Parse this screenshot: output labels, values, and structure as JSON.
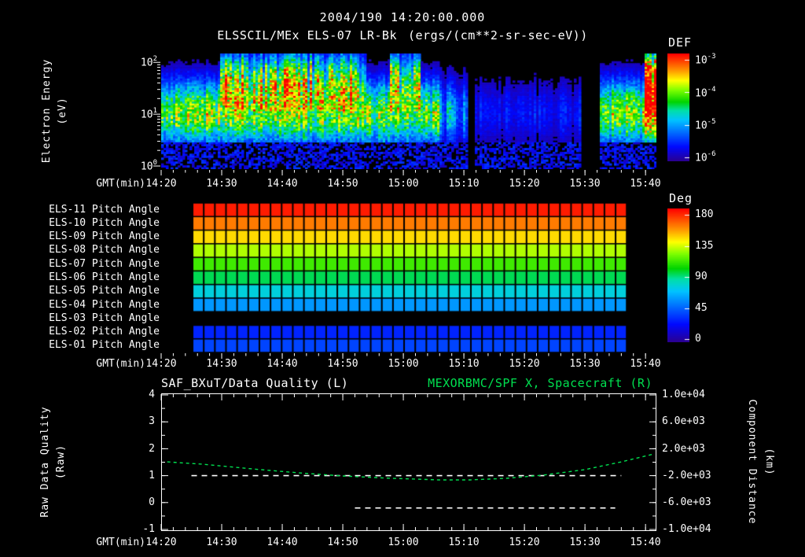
{
  "colors": {
    "background": "#000000",
    "text": "#ffffff",
    "accent_green": "#00e050",
    "axis": "#ffffff",
    "colormap": {
      "positions": [
        0,
        0.13,
        0.27,
        0.38,
        0.47,
        0.55,
        0.66,
        0.75,
        0.85,
        1.0
      ],
      "colors": [
        "#2a0092",
        "#0008ff",
        "#0070ff",
        "#00c3ff",
        "#00e0a8",
        "#00d400",
        "#7dff00",
        "#ffff00",
        "#ff9000",
        "#ff0000"
      ]
    }
  },
  "header": {
    "timestamp": "2004/190 14:20:00.000",
    "instrument": "ELSSCIL/MEx ELS-07 LR-Bk",
    "units": "(ergs/(cm**2-sr-sec-eV))"
  },
  "time_axis": {
    "label": "GMT(min)",
    "ticks": [
      "14:20",
      "14:30",
      "14:40",
      "14:50",
      "15:00",
      "15:10",
      "15:20",
      "15:30",
      "15:40"
    ],
    "minutes_total": 81.8,
    "minor_step_min": 2
  },
  "chart_data": [
    {
      "type": "heatmap",
      "name": "electron-energy-spectrogram",
      "title": "ELSSCIL/MEx ELS-07 LR-Bk",
      "units": "(ergs/(cm**2-sr-sec-eV))",
      "xlabel": "GMT(min)",
      "x_ticks": [
        "14:20",
        "14:30",
        "14:40",
        "14:50",
        "15:00",
        "15:10",
        "15:20",
        "15:30",
        "15:40"
      ],
      "ylabel": "Electron Energy",
      "ylabel_units": "(eV)",
      "y_scale": "log",
      "y_range_ev": [
        0.87,
        148
      ],
      "y_ticks": [
        {
          "base": "10",
          "exp": "2"
        },
        {
          "base": "10",
          "exp": "1"
        },
        {
          "base": "10",
          "exp": "0"
        }
      ],
      "colorbar_title": "DEF",
      "colorbar_ticks": [
        {
          "base": "10",
          "exp": "-3"
        },
        {
          "base": "10",
          "exp": "-4"
        },
        {
          "base": "10",
          "exp": "-5"
        },
        {
          "base": "10",
          "exp": "-6"
        }
      ],
      "colorbar_tick_fracs": [
        0.058,
        0.358,
        0.664,
        0.963
      ],
      "features": {
        "main_band_center_log_ev": 1.02,
        "main_band_width_log": 0.6,
        "main_band_peak_value": 0.62,
        "bright_windows_frac": [
          [
            0.119,
            0.413
          ],
          [
            0.46,
            0.524
          ],
          [
            0.978,
            1.0
          ]
        ],
        "dim_windows_frac": [
          [
            0.563,
            0.617,
            0.55
          ],
          [
            0.632,
            0.849,
            0.2
          ]
        ],
        "blackout_windows_frac": [
          [
            0.617,
            0.632
          ],
          [
            0.849,
            0.884
          ]
        ],
        "low_energy_speckle_below_log_ev": 0.45,
        "bright_patch_center_log_ev": 1.72,
        "bright_patch_width_log": 0.5,
        "bright_patch_amp": 0.5,
        "seed": 20040190
      }
    },
    {
      "type": "heatmap",
      "name": "pitch-angle-panel",
      "xlabel": "GMT(min)",
      "colorbar_title": "Deg",
      "colorbar_ticks": [
        "180",
        "135",
        "90",
        "45",
        "0"
      ],
      "colorbar_tick_fracs": [
        0.047,
        0.282,
        0.512,
        0.747,
        0.976
      ],
      "deg_range": [
        0,
        180
      ],
      "band_extent_frac": [
        0.0635,
        0.94
      ],
      "n_time_bins": 39,
      "rows": [
        {
          "label": "ELS-11 Pitch Angle",
          "deg": 175
        },
        {
          "label": "ELS-10 Pitch Angle",
          "deg": 157
        },
        {
          "label": "ELS-09 Pitch Angle",
          "deg": 141
        },
        {
          "label": "ELS-08 Pitch Angle",
          "deg": 125
        },
        {
          "label": "ELS-07 Pitch Angle",
          "deg": 109
        },
        {
          "label": "ELS-06 Pitch Angle",
          "deg": 92
        },
        {
          "label": "ELS-05 Pitch Angle",
          "deg": 75
        },
        {
          "label": "ELS-04 Pitch Angle",
          "deg": 58
        },
        {
          "label": "ELS-03 Pitch Angle",
          "deg": null
        },
        {
          "label": "ELS-02 Pitch Angle",
          "deg": 30
        },
        {
          "label": "ELS-01 Pitch Angle",
          "deg": 38
        }
      ]
    },
    {
      "type": "line",
      "name": "quality-and-spacecraft-x",
      "title_left": "SAF_BXuT/Data Quality (L)",
      "title_right": "MEXORBMC/SPF X, Spacecraft (R)",
      "xlabel": "GMT(min)",
      "y_left": {
        "label": "Raw Data Quality",
        "label_units": "(Raw)",
        "ticks": [
          "4",
          "3",
          "2",
          "1",
          "0",
          "-1"
        ],
        "tick_values": [
          4,
          3,
          2,
          1,
          0,
          -1
        ],
        "range": [
          4.06,
          -1.06
        ]
      },
      "y_right": {
        "label": "Component Distance",
        "label_units": "(km)",
        "ticks": [
          "1.0e+04",
          "6.0e+03",
          "2.0e+03",
          "-2.0e+03",
          "-6.0e+03",
          "-1.0e+04"
        ],
        "tick_values": [
          10000,
          6000,
          2000,
          -2000,
          -6000,
          -10000
        ],
        "range": [
          10230,
          -10230
        ]
      },
      "series": [
        {
          "name": "Raw Data Quality",
          "axis": "left",
          "color": "#ffffff",
          "style": "dashed",
          "segments": [
            {
              "value": 1,
              "t_start_min": 5,
              "t_end_min": 76
            },
            {
              "value": -0.2,
              "t_start_min": 32,
              "t_end_min": 75
            }
          ]
        },
        {
          "name": "MEX Spacecraft X",
          "axis": "right",
          "color": "#00e050",
          "style": "dashed",
          "t_min": [
            1,
            7,
            15,
            23,
            30,
            38,
            46,
            51,
            57,
            63,
            70,
            76,
            81.5
          ],
          "x_km": [
            50,
            -300,
            -1000,
            -1600,
            -2050,
            -2400,
            -2630,
            -2630,
            -2400,
            -1930,
            -1100,
            50,
            1250
          ]
        }
      ]
    }
  ]
}
